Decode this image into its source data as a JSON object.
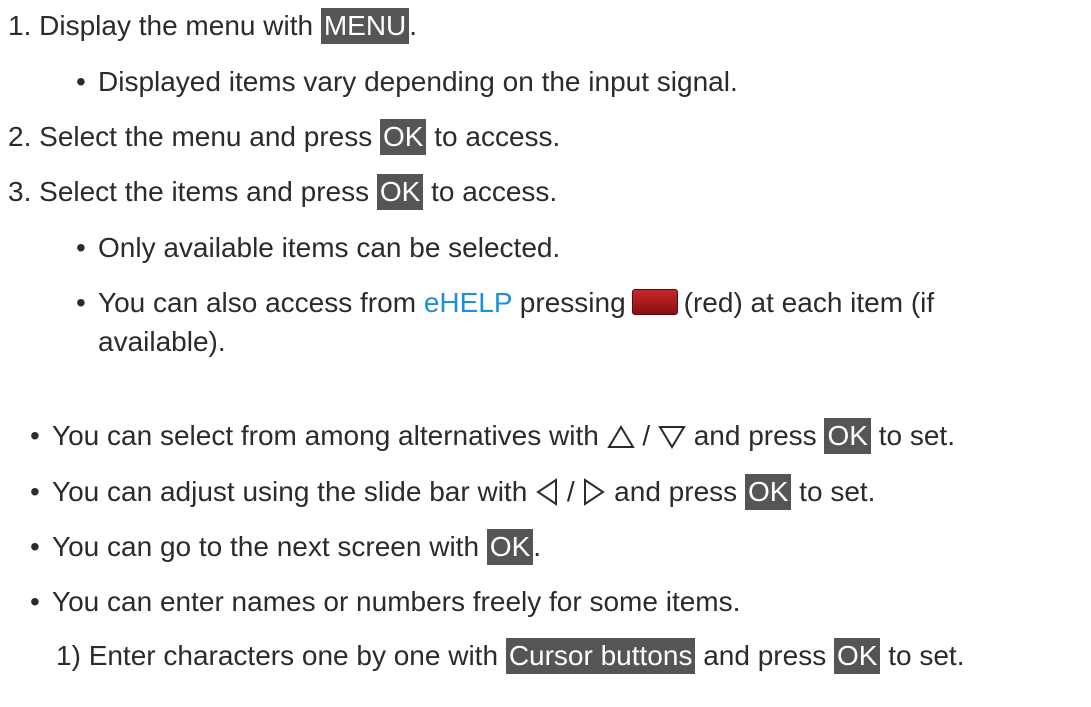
{
  "steps": [
    {
      "num": "1.",
      "text_before": "Display the menu with ",
      "key": "MENU",
      "text_after": "."
    },
    {
      "num": "2.",
      "text_before": "Select the menu and press ",
      "key": "OK",
      "text_after": " to access."
    },
    {
      "num": "3.",
      "text_before": "Select the items and press ",
      "key": "OK",
      "text_after": " to access."
    }
  ],
  "step1_bullet": "Displayed items vary depending on the input signal.",
  "step3_bullets": {
    "b1": "Only available items can be selected.",
    "b2_before": "You can also access from ",
    "b2_link": "eHELP",
    "b2_mid": " pressing",
    "b2_after": "(red) at each item (if",
    "b2_cont": "available)."
  },
  "tips": {
    "t1_before": "You can select from among alternatives with",
    "t1_sep": "/",
    "t1_mid": " and press ",
    "t1_key": "OK",
    "t1_after": " to set.",
    "t2_before": "You can adjust using the slide bar with",
    "t2_sep": "/",
    "t2_mid": " and press ",
    "t2_key": "OK",
    "t2_after": " to set.",
    "t3_before": "You can go to the next screen with ",
    "t3_key": "OK",
    "t3_after": ".",
    "t4": "You can enter names or numbers freely for some items."
  },
  "substep": {
    "num": "1)",
    "text_before": "Enter characters one by one with ",
    "key1": "Cursor buttons",
    "text_mid": " and press ",
    "key2": "OK",
    "text_after": " to set."
  },
  "colors": {
    "key_bg": "#555555",
    "link": "#1e90d6",
    "red_button": "#b01c20"
  },
  "icons": [
    "bullet-icon",
    "red-button-icon",
    "up-arrow-icon",
    "down-arrow-icon",
    "left-arrow-icon",
    "right-arrow-icon"
  ]
}
